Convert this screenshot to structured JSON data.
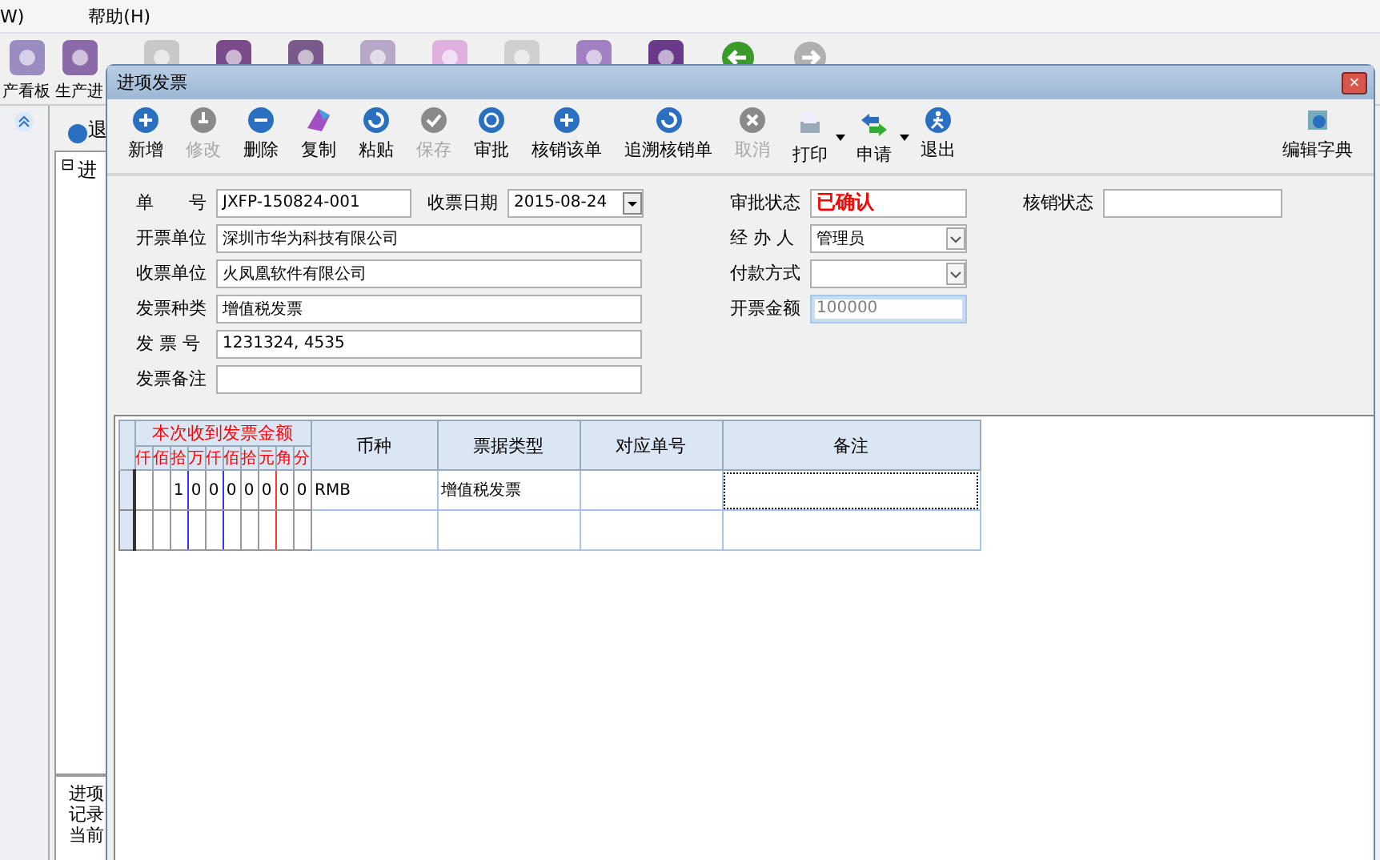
{
  "app": {
    "menu": [
      "W)",
      "帮助(H)"
    ],
    "toolbar": [
      "产看板",
      "生产进"
    ],
    "side": {
      "exit_label": "退",
      "tree_item": "进",
      "tree_expander": "⊟",
      "info_lines": [
        "进项",
        "记录",
        "当前"
      ]
    }
  },
  "dialog": {
    "title": "进项发票",
    "close": "×",
    "toolbar": [
      {
        "label": "新增",
        "disabled": false,
        "dropdown": false
      },
      {
        "label": "修改",
        "disabled": true,
        "dropdown": false
      },
      {
        "label": "删除",
        "disabled": false,
        "dropdown": false
      },
      {
        "label": "复制",
        "disabled": false,
        "dropdown": false
      },
      {
        "label": "粘贴",
        "disabled": false,
        "dropdown": false
      },
      {
        "label": "保存",
        "disabled": true,
        "dropdown": false
      },
      {
        "label": "审批",
        "disabled": false,
        "dropdown": false
      },
      {
        "label": "核销该单",
        "disabled": false,
        "dropdown": false
      },
      {
        "label": "追溯核销单",
        "disabled": false,
        "dropdown": false
      },
      {
        "label": "取消",
        "disabled": true,
        "dropdown": false
      },
      {
        "label": "打印",
        "disabled": false,
        "dropdown": true
      },
      {
        "label": "申请",
        "disabled": false,
        "dropdown": true
      },
      {
        "label": "退出",
        "disabled": false,
        "dropdown": false
      }
    ],
    "toolbar_right": {
      "label": "编辑字典"
    },
    "left_fields": [
      {
        "label": "单　　号",
        "value": "JXFP-150824-001",
        "kind": "text",
        "extra": {
          "label": "收票日期",
          "value": "2015-08-24",
          "kind": "date"
        }
      },
      {
        "label": "开票单位",
        "value": "深圳市华为科技有限公司",
        "kind": "text"
      },
      {
        "label": "收票单位",
        "value": "火凤凰软件有限公司",
        "kind": "text"
      },
      {
        "label": "发票种类",
        "value": "增值税发票",
        "kind": "text"
      },
      {
        "label": "发 票 号",
        "value": "1231324, 4535",
        "kind": "text"
      },
      {
        "label": "发票备注",
        "kind": "text"
      }
    ],
    "right_fields": [
      {
        "label": "审批状态",
        "value": "已确认",
        "kind": "status",
        "extra": {
          "label": "核销状态",
          "kind": "text"
        }
      },
      {
        "label": "经 办 人",
        "value": "管理员",
        "kind": "select"
      },
      {
        "label": "付款方式",
        "kind": "select"
      },
      {
        "label": "开票金额",
        "value": "100000",
        "kind": "readonly"
      }
    ],
    "grid": {
      "amount_title": "本次收到发票金额",
      "digits": [
        "仟",
        "佰",
        "拾",
        "万",
        "仟",
        "佰",
        "拾",
        "元",
        "角",
        "分"
      ],
      "columns": [
        "币种",
        "票据类型",
        "对应单号",
        "备注"
      ],
      "rows": [
        {
          "amount": [
            "1",
            "0",
            "0",
            "0",
            "0",
            "0",
            "0",
            "0"
          ],
          "cells": [
            "RMB",
            "增值税发票"
          ],
          "focused": true
        },
        {
          "focused": false
        }
      ]
    }
  }
}
